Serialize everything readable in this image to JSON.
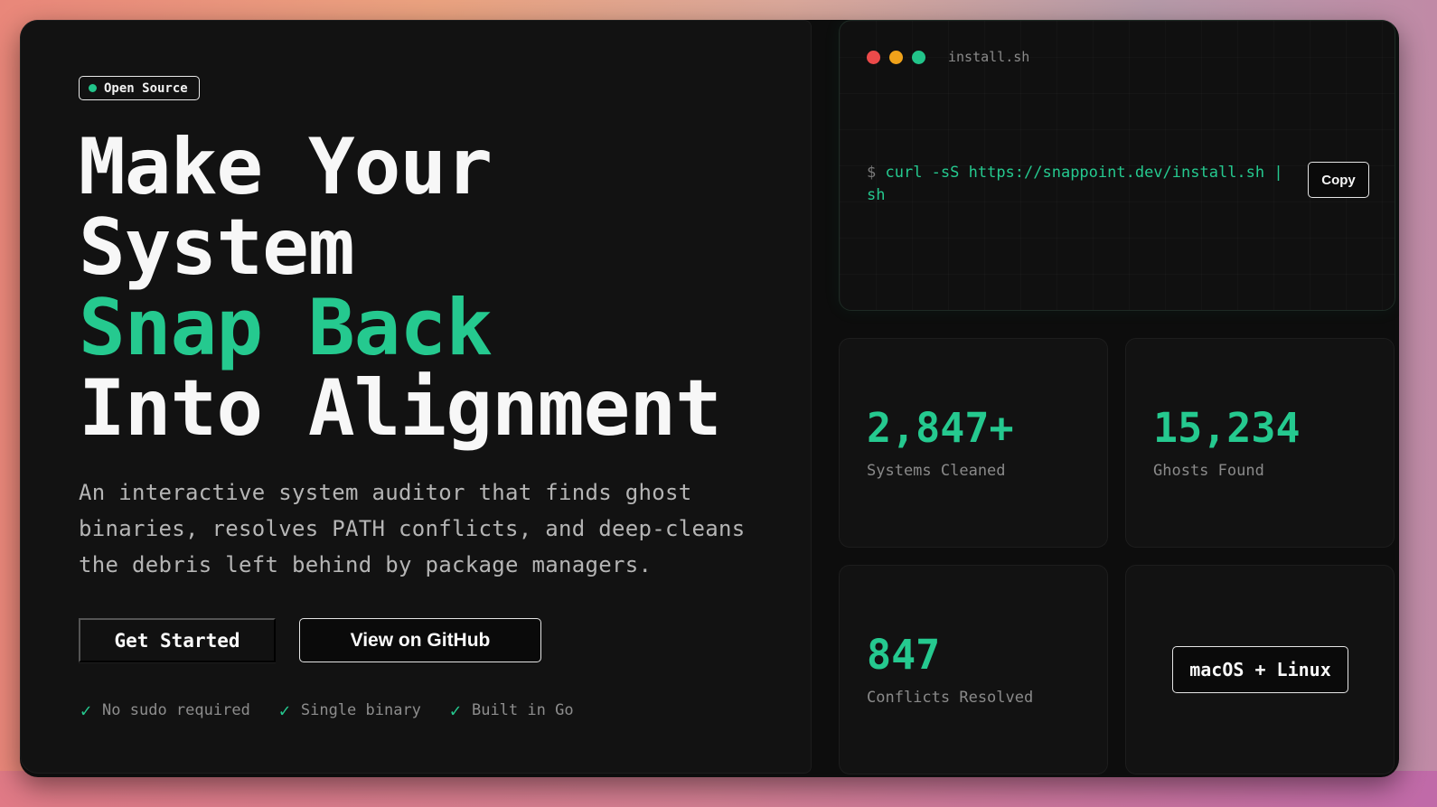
{
  "badge": {
    "label": "Open Source"
  },
  "hero": {
    "line1": "Make Your",
    "line2": "System",
    "line3": "Snap Back",
    "line4": "Into Alignment",
    "subtitle": "An interactive system auditor that finds ghost binaries, resolves PATH conflicts, and deep-cleans the debris left behind by package managers."
  },
  "buttons": {
    "primary": "Get Started",
    "secondary": "View on GitHub"
  },
  "features": [
    {
      "label": "No sudo required"
    },
    {
      "label": "Single binary"
    },
    {
      "label": "Built in Go"
    }
  ],
  "terminal": {
    "filename": "install.sh",
    "prompt": "$",
    "command": "curl -sS https://snappoint.dev/install.sh | sh",
    "copy_label": "Copy"
  },
  "stats": [
    {
      "value": "2,847+",
      "label": "Systems Cleaned"
    },
    {
      "value": "15,234",
      "label": "Ghosts Found"
    },
    {
      "value": "847",
      "label": "Conflicts Resolved"
    }
  ],
  "platform": {
    "label": "macOS + Linux"
  },
  "colors": {
    "accent": "#25c98f",
    "background": "#0d0d0d",
    "panel": "#121212"
  }
}
